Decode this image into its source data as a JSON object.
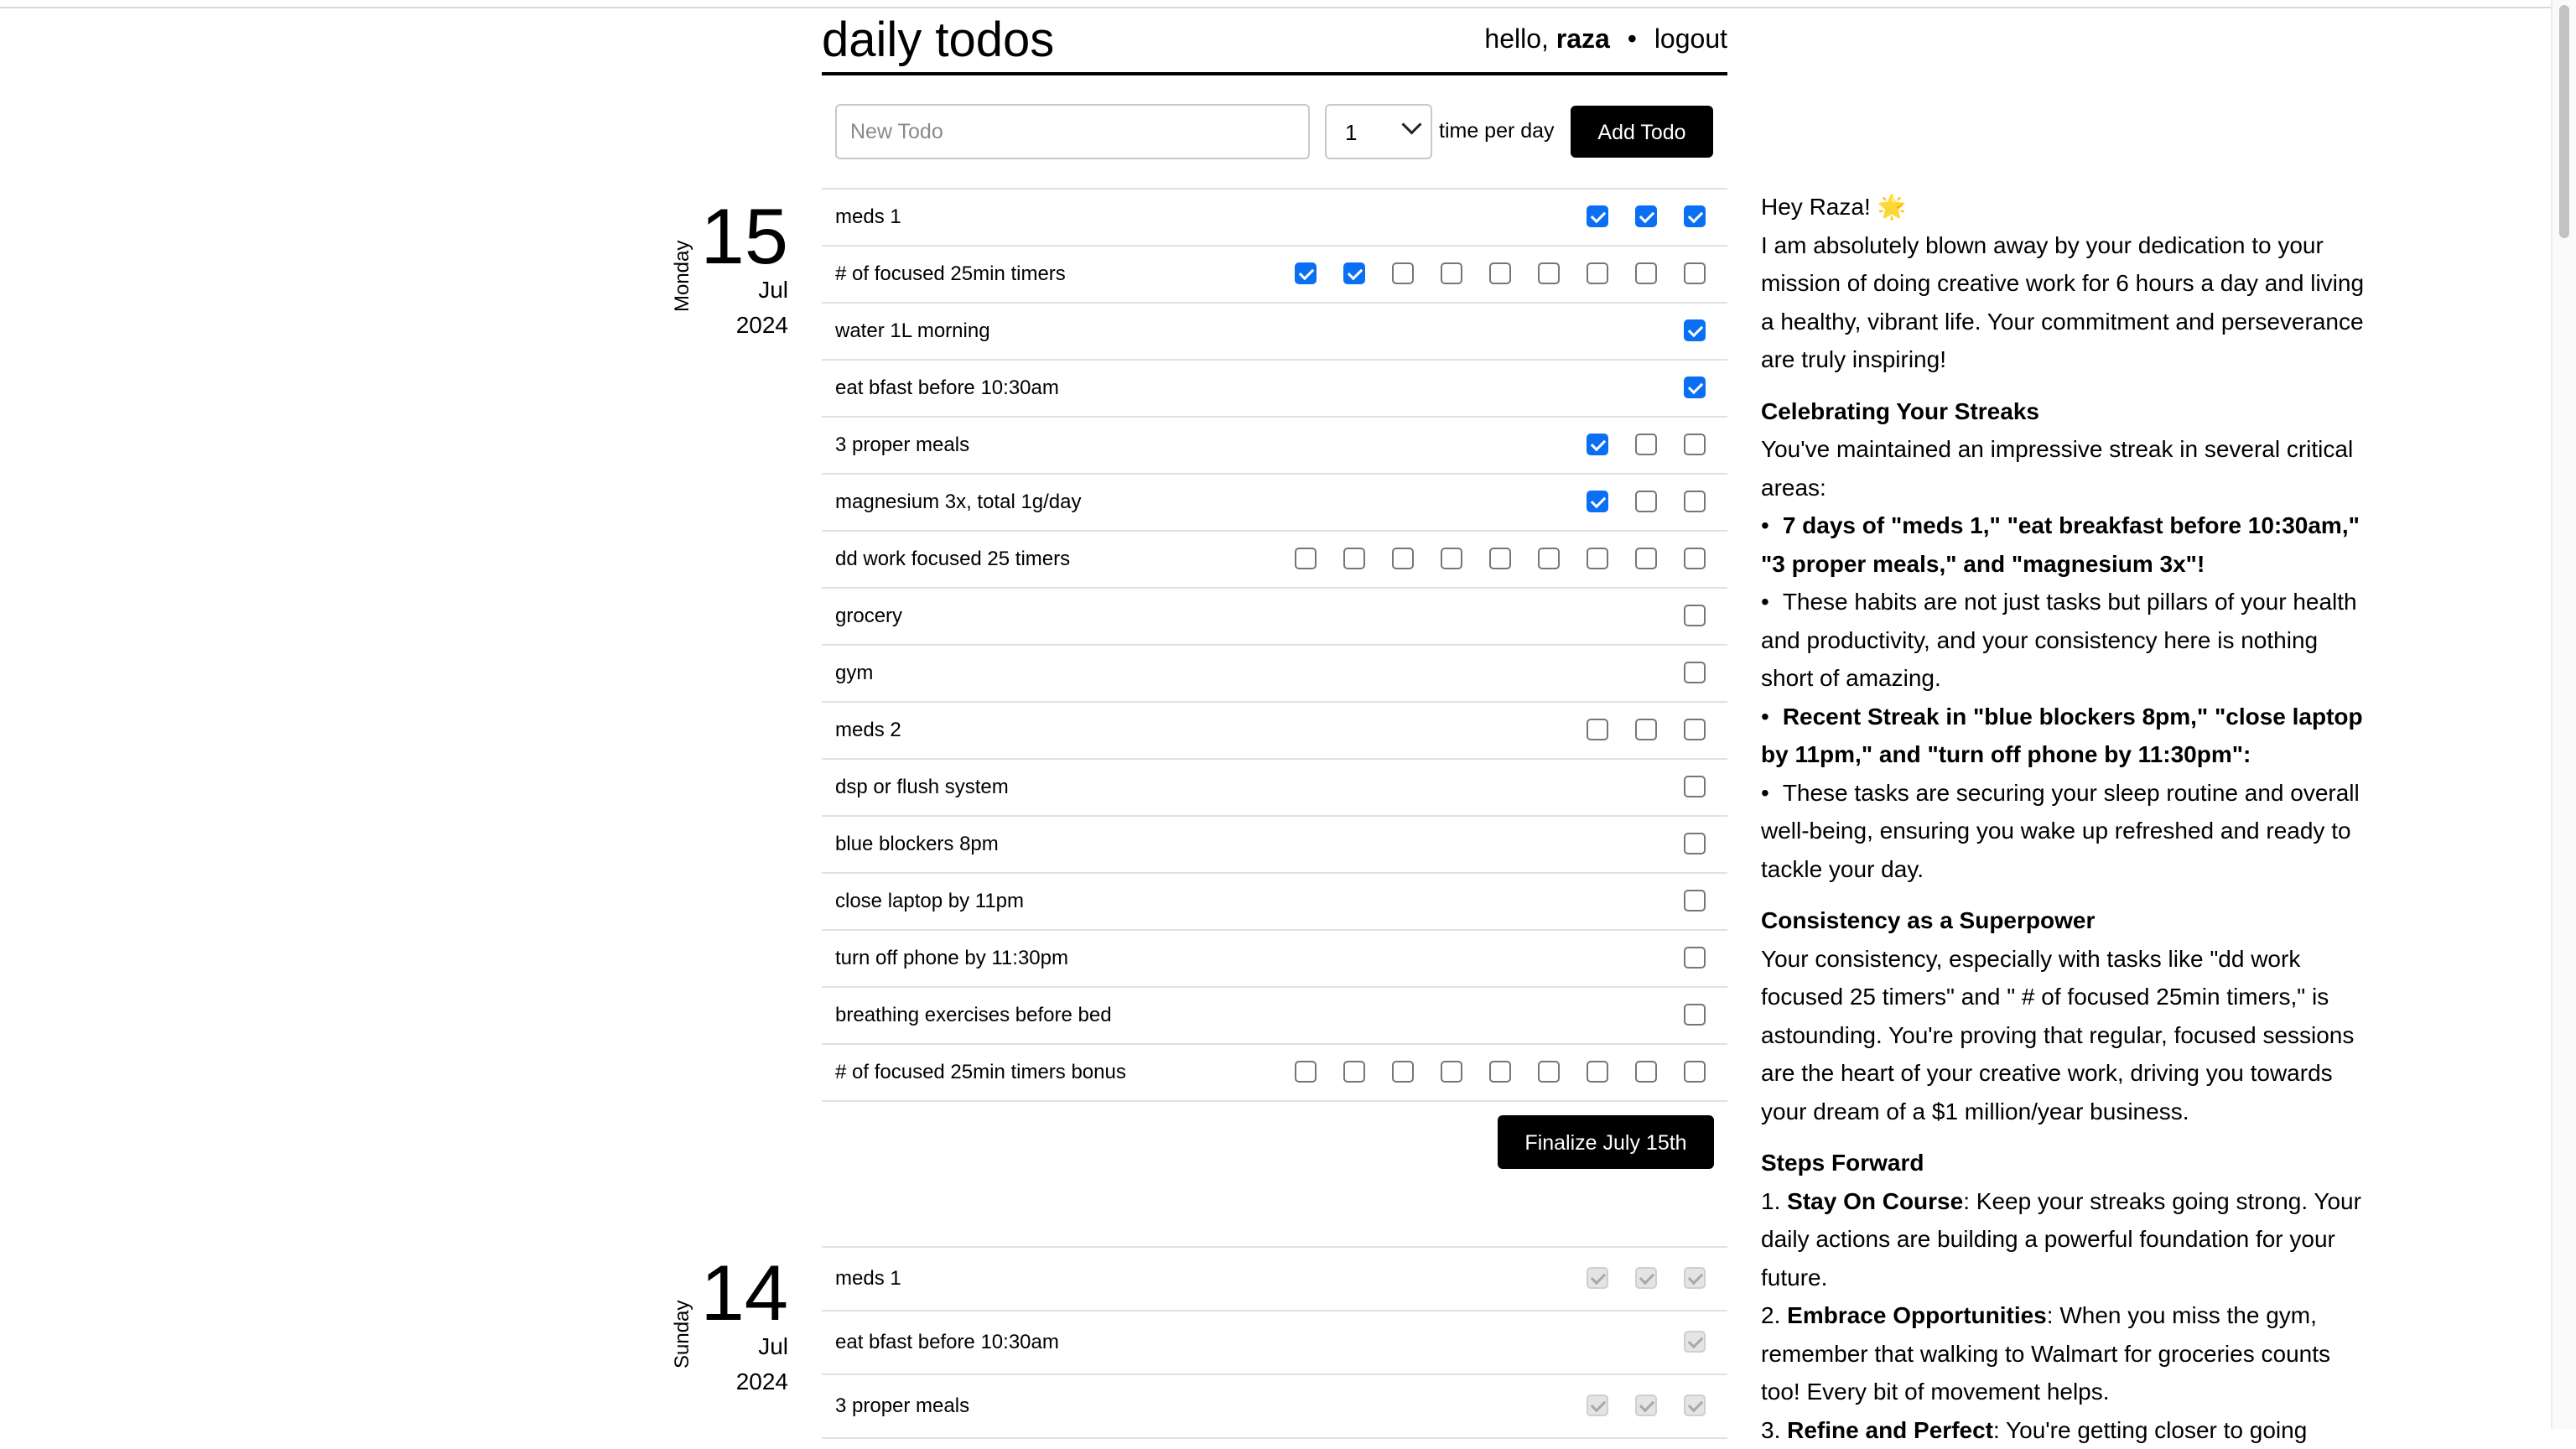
{
  "header": {
    "title": "daily todos",
    "greeting": "hello,",
    "user": "raza",
    "separator": "•",
    "logout": "logout"
  },
  "form": {
    "placeholder": "New Todo",
    "times_value": "1",
    "times_label": "time per day",
    "add_label": "Add Todo"
  },
  "today": {
    "weekday": "Monday",
    "day": "15",
    "month": "Jul",
    "year": "2024",
    "todos": [
      {
        "label": "meds 1",
        "checks": [
          true,
          true,
          true
        ]
      },
      {
        "label": "# of focused 25min timers",
        "checks": [
          true,
          true,
          false,
          false,
          false,
          false,
          false,
          false,
          false
        ]
      },
      {
        "label": "water 1L morning",
        "checks": [
          true
        ]
      },
      {
        "label": "eat bfast before 10:30am",
        "checks": [
          true
        ]
      },
      {
        "label": "3 proper meals",
        "checks": [
          true,
          false,
          false
        ]
      },
      {
        "label": "magnesium 3x, total 1g/day",
        "checks": [
          true,
          false,
          false
        ]
      },
      {
        "label": "dd work focused 25 timers",
        "checks": [
          false,
          false,
          false,
          false,
          false,
          false,
          false,
          false,
          false
        ]
      },
      {
        "label": "grocery",
        "checks": [
          false
        ]
      },
      {
        "label": "gym",
        "checks": [
          false
        ]
      },
      {
        "label": "meds 2",
        "checks": [
          false,
          false,
          false
        ]
      },
      {
        "label": "dsp or flush system",
        "checks": [
          false
        ]
      },
      {
        "label": "blue blockers 8pm",
        "checks": [
          false
        ]
      },
      {
        "label": "close laptop by 11pm",
        "checks": [
          false
        ]
      },
      {
        "label": "turn off phone by 11:30pm",
        "checks": [
          false
        ]
      },
      {
        "label": "breathing exercises before bed",
        "checks": [
          false
        ]
      },
      {
        "label": "# of focused 25min timers bonus",
        "checks": [
          false,
          false,
          false,
          false,
          false,
          false,
          false,
          false,
          false
        ]
      }
    ],
    "finalize_label": "Finalize July 15th"
  },
  "yesterday": {
    "weekday": "Sunday",
    "day": "14",
    "month": "Jul",
    "year": "2024",
    "todos": [
      {
        "label": "meds 1",
        "checks": [
          true,
          true,
          true
        ]
      },
      {
        "label": "eat bfast before 10:30am",
        "checks": [
          true
        ]
      },
      {
        "label": "3 proper meals",
        "checks": [
          true,
          true,
          true
        ]
      }
    ]
  },
  "message": {
    "greeting": "Hey Raza! 🌟",
    "intro": "I am absolutely blown away by your dedication to your mission of doing creative work for 6 hours a day and living a healthy, vibrant life. Your commitment and perseverance are truly inspiring!",
    "h1": "Celebrating Your Streaks",
    "p1": "You've maintained an impressive streak in several critical areas:",
    "b1": "7 days of \"meds 1,\" \"eat breakfast before 10:30am,\" \"3 proper meals,\" and \"magnesium 3x\"!",
    "b2": "These habits are not just tasks but pillars of your health and productivity, and your consistency here is nothing short of amazing.",
    "b3": "Recent Streak in \"blue blockers 8pm,\" \"close laptop by 11pm,\" and \"turn off phone by 11:30pm\":",
    "b4": "These tasks are securing your sleep routine and overall well-being, ensuring you wake up refreshed and ready to tackle your day.",
    "bullet": "•",
    "h2": "Consistency as a Superpower",
    "p2": "Your consistency, especially with tasks like \"dd work focused 25 timers\" and \" # of focused 25min timers,\" is astounding. You're proving that regular, focused sessions are the heart of your creative work, driving you towards your dream of a $1 million/year business.",
    "h3": "Steps Forward",
    "s1_num": "1.",
    "s1_bold": "Stay On Course",
    "s1_text": ": Keep your streaks going strong. Your daily actions are building a powerful foundation for your future.",
    "s2_num": "2.",
    "s2_bold": "Embrace Opportunities",
    "s2_text": ": When you miss the gym, remember that walking to Walmart for groceries counts too! Every bit of movement helps.",
    "s3_num": "3.",
    "s3_bold": "Refine and Perfect",
    "s3_text": ": You're getting closer to going"
  }
}
